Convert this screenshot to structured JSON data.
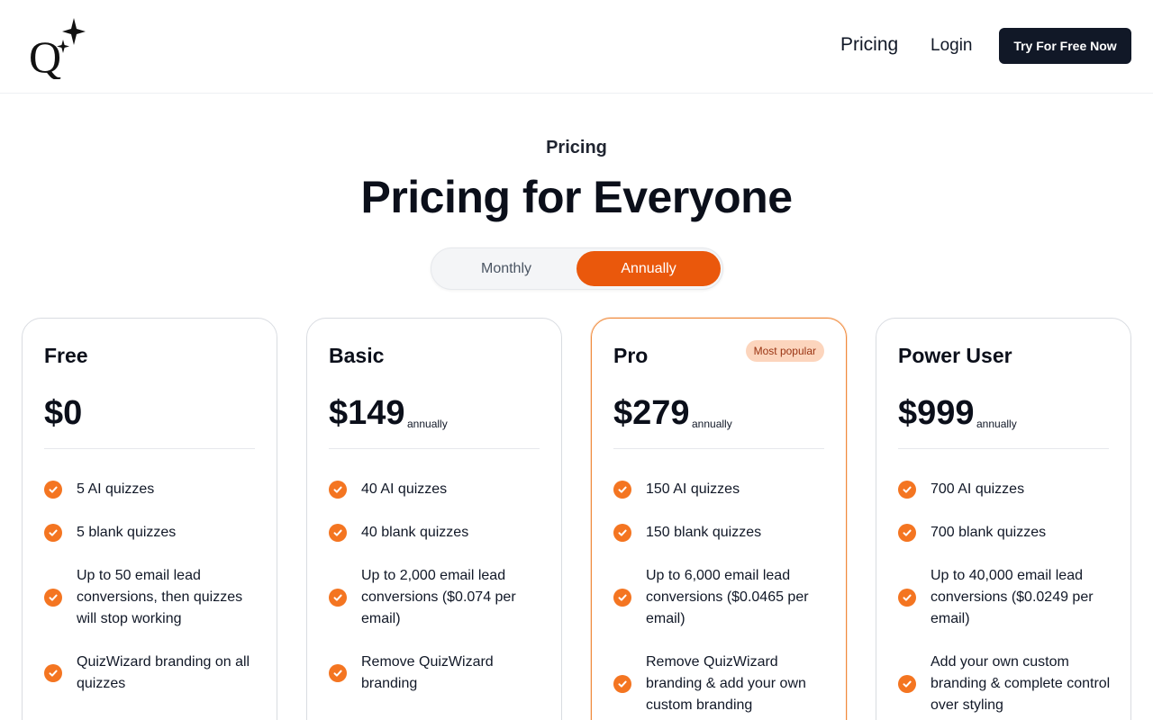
{
  "header": {
    "logo_letter": "Q",
    "nav": {
      "pricing": "Pricing",
      "login": "Login"
    },
    "cta_label": "Try For Free Now"
  },
  "hero": {
    "eyebrow": "Pricing",
    "title": "Pricing for Everyone"
  },
  "billing_toggle": {
    "options": [
      "Monthly",
      "Annually"
    ],
    "selected": "Annually"
  },
  "colors": {
    "accent": "#ea580c",
    "check": "#f47521",
    "dark": "#111827",
    "badge_bg": "#fcd5bd"
  },
  "plans": [
    {
      "name": "Free",
      "price": "$0",
      "period": "",
      "badge": "",
      "features": [
        "5 AI quizzes",
        "5 blank quizzes",
        "Up to 50 email lead conversions, then quizzes will stop working",
        "QuizWizard branding on all quizzes"
      ]
    },
    {
      "name": "Basic",
      "price": "$149",
      "period": "annually",
      "badge": "",
      "features": [
        "40 AI quizzes",
        "40 blank quizzes",
        "Up to 2,000 email lead conversions ($0.074 per email)",
        "Remove QuizWizard branding"
      ]
    },
    {
      "name": "Pro",
      "price": "$279",
      "period": "annually",
      "badge": "Most popular",
      "features": [
        "150 AI quizzes",
        "150 blank quizzes",
        "Up to 6,000 email lead conversions ($0.0465 per email)",
        "Remove QuizWizard branding & add your own custom branding"
      ]
    },
    {
      "name": "Power User",
      "price": "$999",
      "period": "annually",
      "badge": "",
      "features": [
        "700 AI quizzes",
        "700 blank quizzes",
        "Up to 40,000 email lead conversions ($0.0249 per email)",
        "Add your own custom branding & complete control over styling"
      ]
    }
  ]
}
